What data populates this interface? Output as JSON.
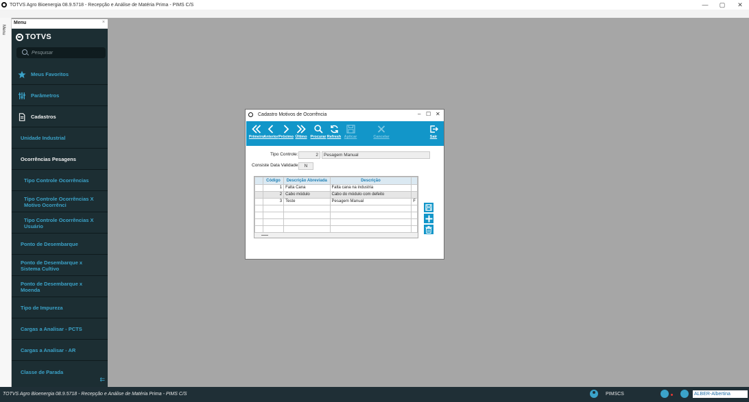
{
  "window": {
    "title": "TOTVS Agro Bioenergia 08.9.5718 - Recepção e Análise de Matéria Prima - PIMS C/S",
    "minimize": "—",
    "maximize": "▢",
    "close": "✕"
  },
  "menu_tab": {
    "label": "Menu"
  },
  "sidebar": {
    "header": "Menu",
    "close": "×",
    "brand": "TOTVS",
    "search_placeholder": "Pesquisar",
    "items": [
      {
        "label": "Meus Favoritos",
        "icon": "star-icon"
      },
      {
        "label": "Parâmetros",
        "icon": "sliders-icon"
      },
      {
        "label": "Cadastros",
        "icon": "document-icon"
      },
      {
        "label": "Unidade Industrial"
      },
      {
        "label": "Ocorrências Pesagens"
      },
      {
        "label": "Tipo Controle Ocorrências"
      },
      {
        "label": "Tipo Controle Ocorrências X Motivo Ocorrênci"
      },
      {
        "label": "Tipo Controle Ocorrências X Usuário"
      },
      {
        "label": "Ponto de Desembarque"
      },
      {
        "label": "Ponto de Desembarque x Sistema Cultivo"
      },
      {
        "label": "Ponto de Desembarque x Moenda"
      },
      {
        "label": "Tipo de Impureza"
      },
      {
        "label": "Cargas a Analisar - PCTS"
      },
      {
        "label": "Cargas a Analisar - AR"
      },
      {
        "label": "Classe de Parada"
      }
    ],
    "collapse_icon": "collapse-menu-icon"
  },
  "dialog": {
    "title": "Cadastro Motivos de Ocorrência",
    "minimize": "–",
    "maximize": "☐",
    "close": "✕",
    "toolbar": {
      "first": "Primeiro",
      "previous": "Anterior",
      "next": "Próximo",
      "last": "Último",
      "search": "Procurar",
      "refresh": "Refresh",
      "save": "Aplicar",
      "cancel": "Cancelar",
      "exit": "Sair"
    },
    "form": {
      "tipo_controle_label": "Tipo Controle:",
      "tipo_controle_code": "2",
      "tipo_controle_desc": "Pesagem Manual",
      "consiste_label": "Consiste Data Validade:",
      "consiste_value": "N"
    },
    "grid": {
      "columns": [
        "Código",
        "Descrição Abreviada",
        "Descrição"
      ],
      "rows": [
        {
          "codigo": "1",
          "abreviada": "Falta Cana",
          "descricao": "Falta cana na industria",
          "extra": ""
        },
        {
          "codigo": "2",
          "abreviada": "Cabo módulo",
          "descricao": "Cabo do módulo com defeito",
          "extra": ""
        },
        {
          "codigo": "3",
          "abreviada": "Teste",
          "descricao": "Pesagem Manual",
          "extra": "F"
        }
      ]
    }
  },
  "statusbar": {
    "text": "TOTVS Agro Bioenergia 08.9.5718 - Recepção e Análise de Matéria Prima - PIMS C/S",
    "database": "PIMSCS",
    "user": "ALBER-Albertina"
  }
}
